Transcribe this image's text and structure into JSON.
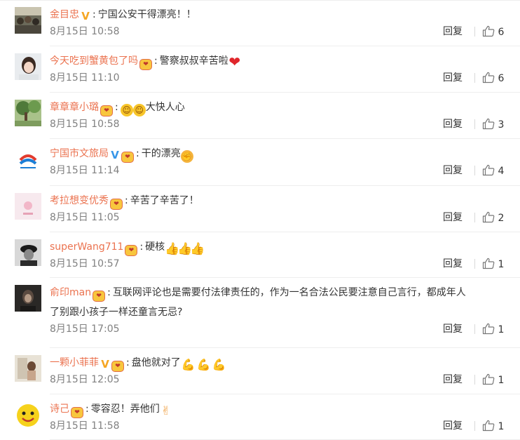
{
  "reply_label": "回复",
  "comments": [
    {
      "name": "金目忠",
      "badge": "v-yellow",
      "text": "宁国公安干得漂亮！！",
      "emojis": [],
      "time": "8月15日 10:58",
      "likes": "6",
      "avatar": "crowd"
    },
    {
      "name": "今天吃到蟹黄包了吗",
      "badge": "vip",
      "text": "警察叔叔辛苦啦",
      "emojis": [
        "heart"
      ],
      "time": "8月15日 11:10",
      "likes": "6",
      "avatar": "girl"
    },
    {
      "name": "章章章小璐",
      "badge": "vip",
      "text": "大快人心",
      "emojis": [
        "face",
        "face"
      ],
      "emojis_before_text": true,
      "time": "8月15日 10:58",
      "likes": "3",
      "avatar": "tree"
    },
    {
      "name": "宁国市文旅局",
      "badge": "v-blue",
      "badge2": "vip",
      "text": "干的漂亮",
      "emojis": [
        "fist"
      ],
      "time": "8月15日 11:14",
      "likes": "4",
      "avatar": "logo"
    },
    {
      "name": "考拉想变优秀",
      "badge": "vip",
      "text": "辛苦了辛苦了！",
      "emojis": [],
      "time": "8月15日 11:05",
      "likes": "2",
      "avatar": "pink"
    },
    {
      "name": "superWang711",
      "badge": "vip",
      "text": "硬核",
      "emojis": [
        "thumb",
        "thumb",
        "thumb"
      ],
      "time": "8月15日 10:57",
      "likes": "1",
      "avatar": "bw"
    },
    {
      "name": "俞印man",
      "badge": "vip",
      "text": "互联网评论也是需要付法律责任的，作为一名合法公民要注意自己言行，都成年人",
      "text2": "了别跟小孩子一样还童言无忌?",
      "emojis": [],
      "time": "8月15日 17:05",
      "likes": "1",
      "avatar": "dark"
    },
    {
      "name": "一颗小菲菲",
      "badge": "v-yellow",
      "badge2": "vip",
      "text": "盘他就对了",
      "emojis": [
        "arm",
        "arm",
        "arm"
      ],
      "time": "8月15日 12:05",
      "likes": "1",
      "avatar": "photo"
    },
    {
      "name": "诗己",
      "badge": "vip",
      "text": "零容忍！弄他们",
      "emojis": [
        "ok"
      ],
      "time": "8月15日 11:58",
      "likes": "1",
      "avatar": "yellow"
    }
  ]
}
